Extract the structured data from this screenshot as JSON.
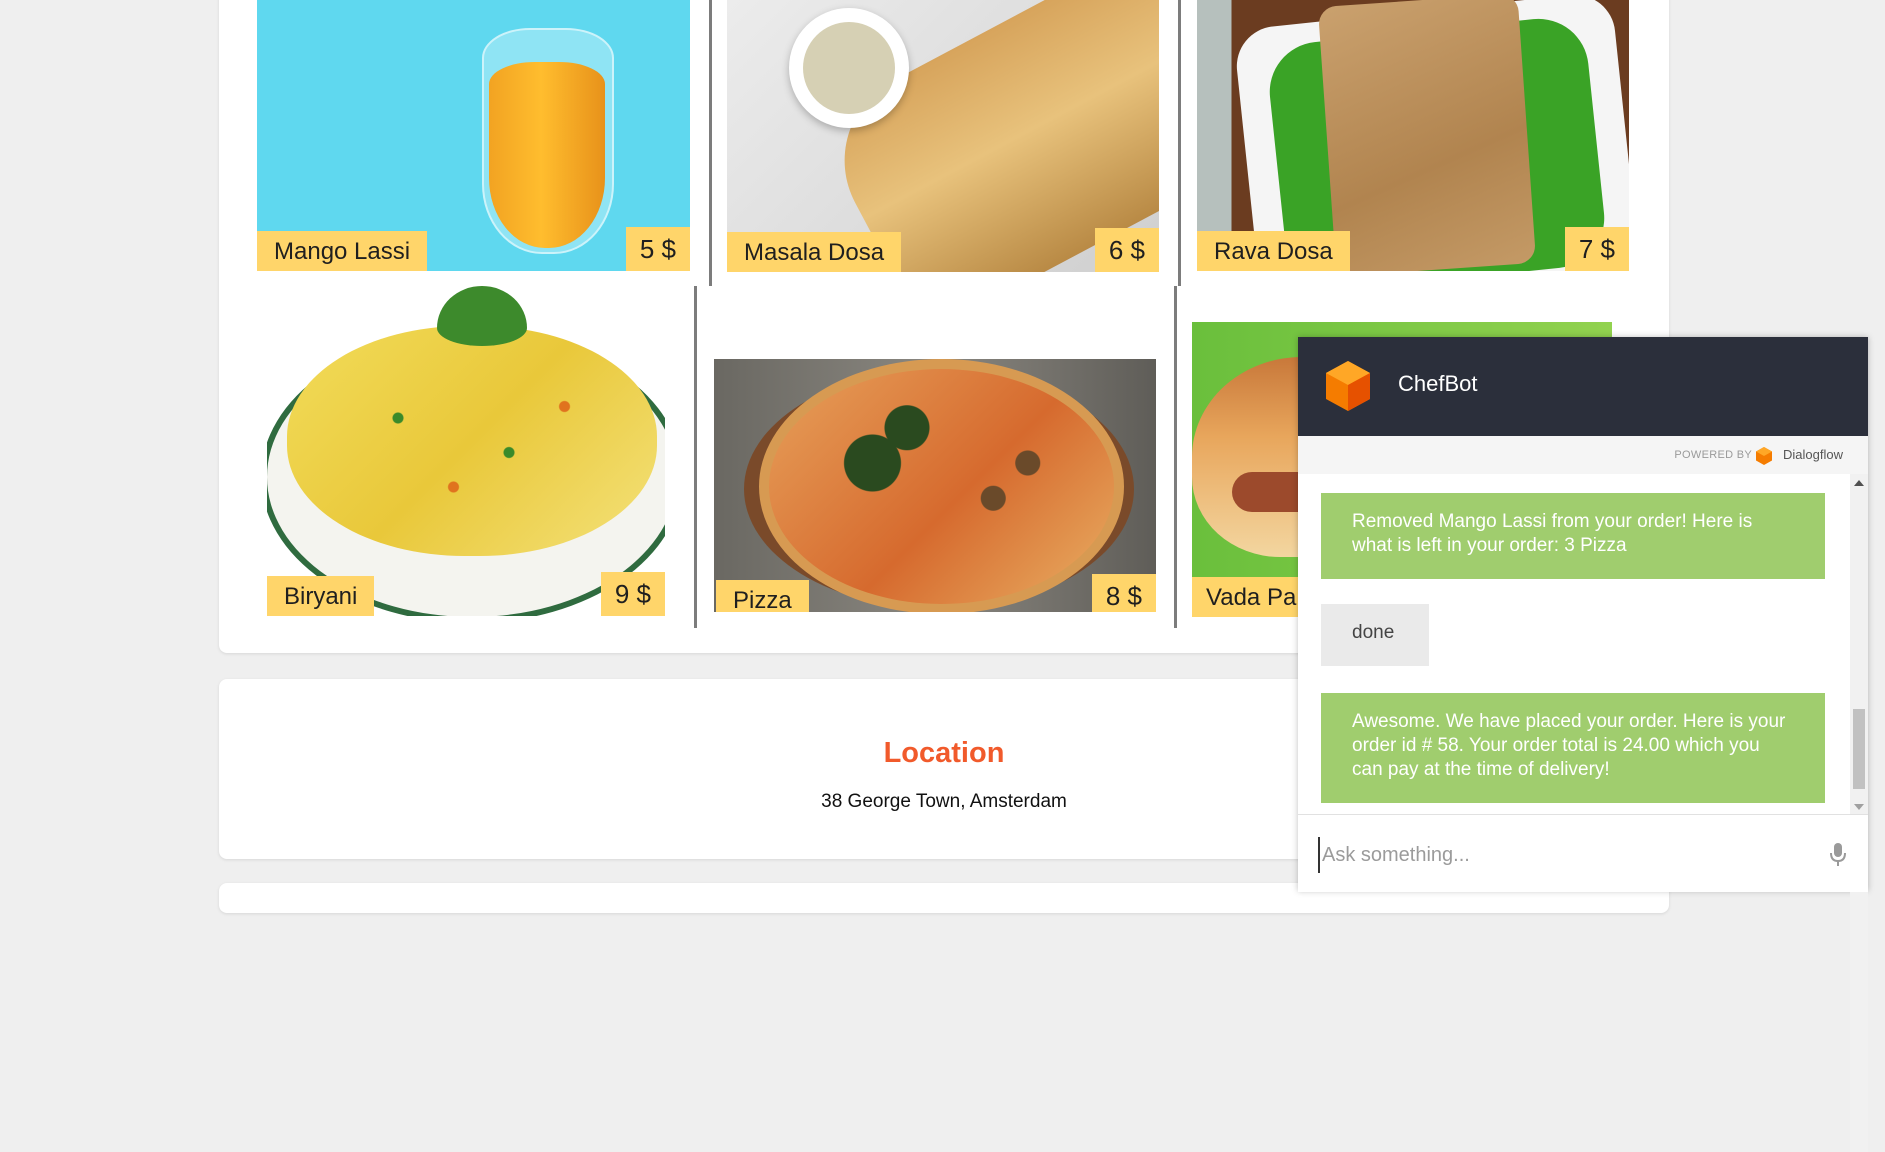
{
  "menu": {
    "items": [
      {
        "name": "Mango Lassi",
        "price": "5 $"
      },
      {
        "name": "Masala Dosa",
        "price": "6 $"
      },
      {
        "name": "Rava Dosa",
        "price": "7 $"
      },
      {
        "name": "Biryani",
        "price": "9 $"
      },
      {
        "name": "Pizza",
        "price": "8 $"
      },
      {
        "name": "Vada Pa",
        "price": ""
      }
    ]
  },
  "location": {
    "title": "Location",
    "address": "38 George Town, Amsterdam"
  },
  "chat": {
    "title": "ChefBot",
    "powered_by": "POWERED BY",
    "provider": "Dialogflow",
    "messages": [
      {
        "from": "bot",
        "text": "Removed Mango Lassi from your order! Here is what is left in your order: 3 Pizza"
      },
      {
        "from": "user",
        "text": "done"
      },
      {
        "from": "bot",
        "text": "Awesome. We have placed your order. Here is your order id # 58. Your order total is 24.00 which you can pay at the time of delivery!"
      }
    ],
    "input_placeholder": "Ask something..."
  },
  "colors": {
    "page_bg": "#efefef",
    "tag_yellow": "#ffd56a",
    "location_title": "#f15a2b",
    "chat_header": "#2b2f3b",
    "bot_bubble": "#a0cd6e",
    "user_bubble": "#eaeaea",
    "dialogflow_orange": "#ef6c00"
  },
  "icons": {
    "chat_logo": "dialogflow-cube-icon",
    "microphone": "microphone-icon"
  }
}
